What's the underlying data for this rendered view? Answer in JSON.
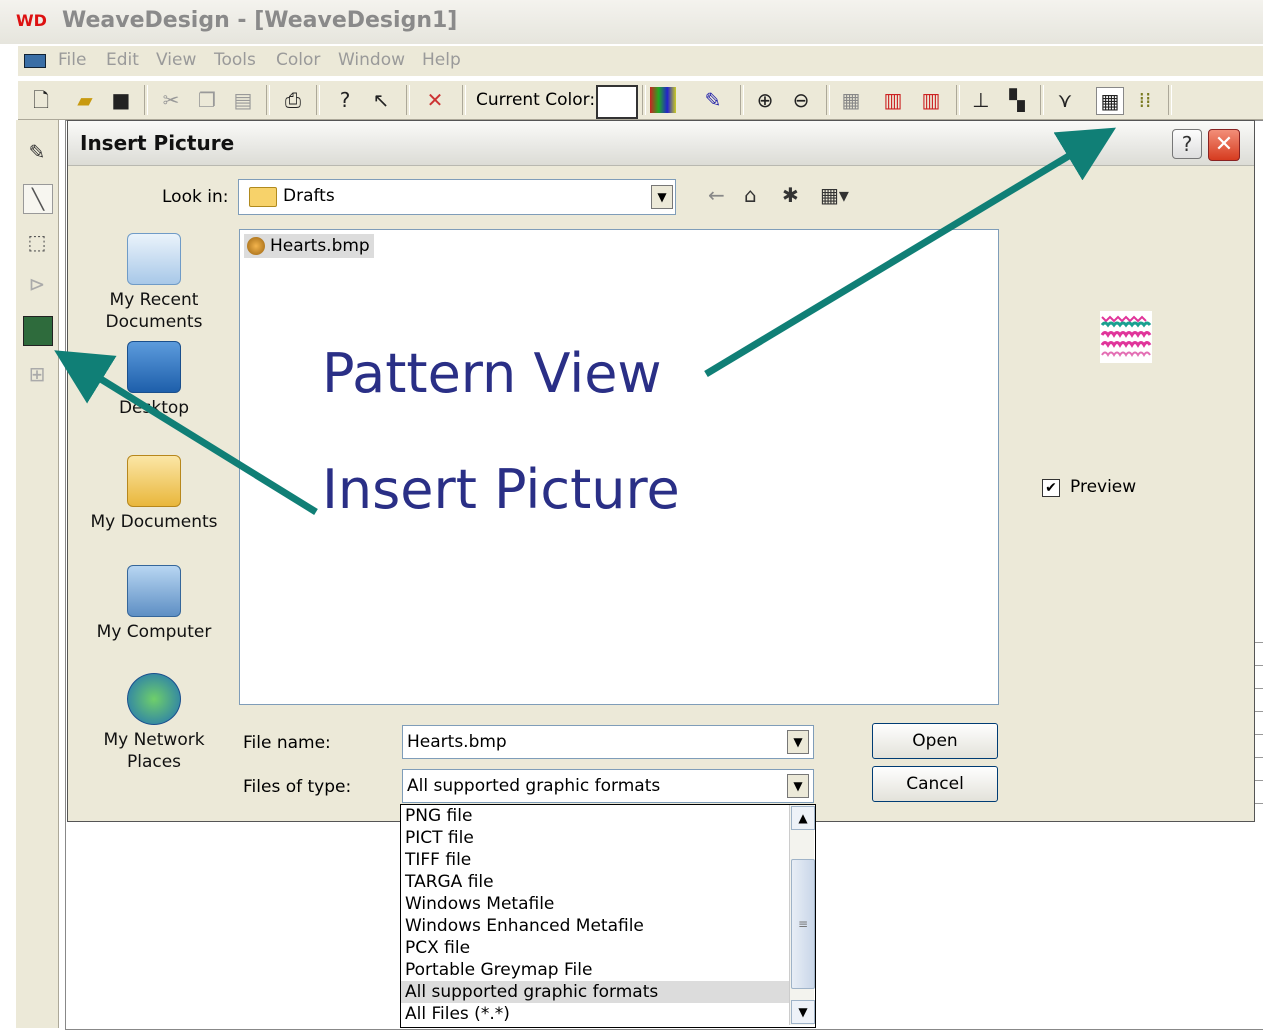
{
  "app": {
    "title": "WeaveDesign - [WeaveDesign1]",
    "logo": "WD"
  },
  "menu": [
    "File",
    "Edit",
    "View",
    "Tools",
    "Color",
    "Window",
    "Help"
  ],
  "toolbar": {
    "current_color_label": "Current Color:"
  },
  "dialog": {
    "title": "Insert Picture",
    "help_label": "?",
    "close_label": "✕",
    "look_in_label": "Look in:",
    "look_in_value": "Drafts",
    "places": [
      {
        "label_lines": [
          "My Recent",
          "Documents"
        ],
        "icon": "recent-documents-icon"
      },
      {
        "label_lines": [
          "Desktop"
        ],
        "icon": "desktop-icon"
      },
      {
        "label_lines": [
          "My Documents"
        ],
        "icon": "my-documents-icon"
      },
      {
        "label_lines": [
          "My Computer"
        ],
        "icon": "my-computer-icon"
      },
      {
        "label_lines": [
          "My Network",
          "Places"
        ],
        "icon": "network-places-icon"
      }
    ],
    "files": [
      "Hearts.bmp"
    ],
    "preview_label": "Preview",
    "file_name_label": "File name:",
    "file_name_value": "Hearts.bmp",
    "files_of_type_label": "Files of type:",
    "files_of_type_value": "All supported graphic formats",
    "open_label": "Open",
    "cancel_label": "Cancel",
    "type_options": [
      "PNG file",
      "PICT file",
      "TIFF file",
      "TARGA file",
      "Windows Metafile",
      "Windows Enhanced Metafile",
      "PCX file",
      "Portable Greymap File",
      "All supported graphic formats",
      "All Files (*.*)"
    ],
    "selected_type_index": 8
  },
  "annotations": {
    "pattern_view": "Pattern View",
    "insert_picture": "Insert Picture",
    "arrow_color": "#107f76"
  }
}
